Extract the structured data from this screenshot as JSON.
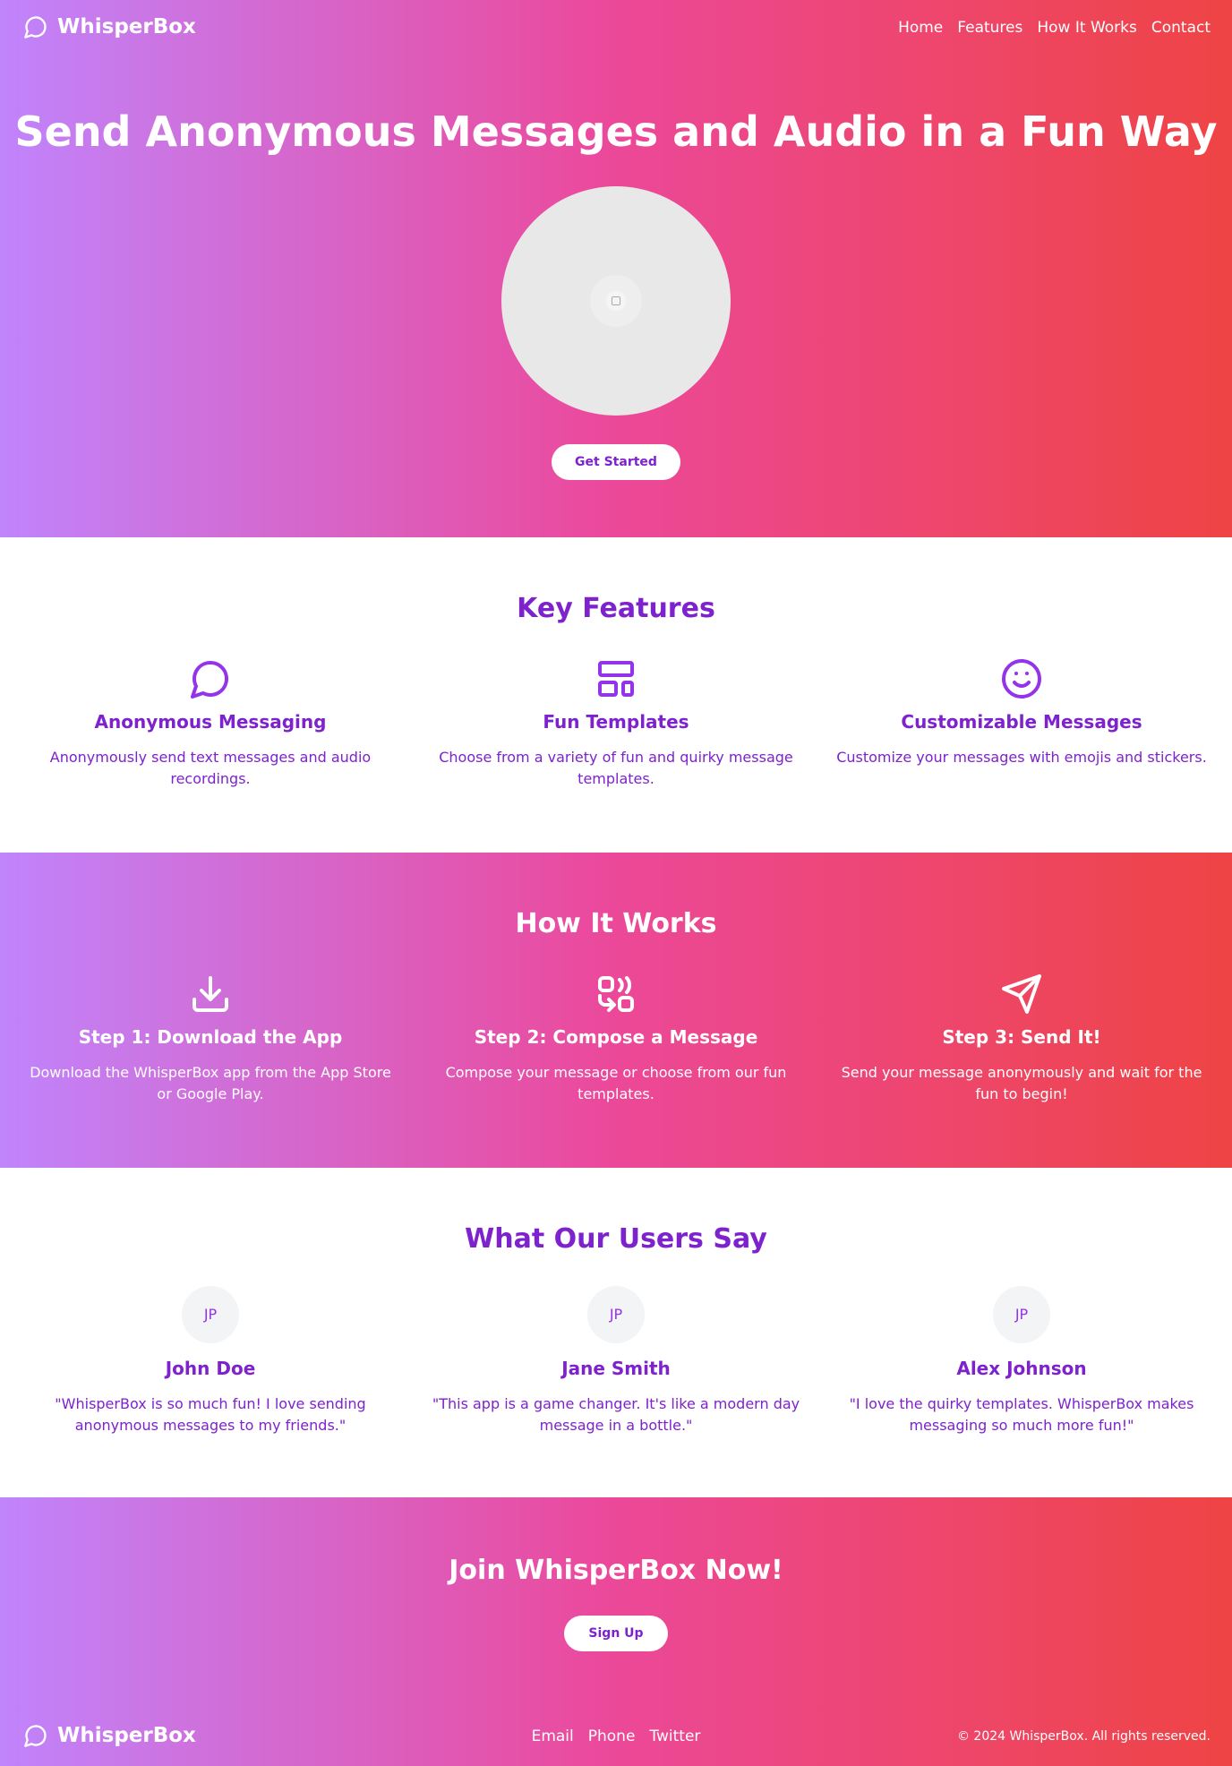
{
  "header": {
    "brand": "WhisperBox",
    "nav": [
      "Home",
      "Features",
      "How It Works",
      "Contact"
    ]
  },
  "hero": {
    "title": "Send Anonymous Messages and Audio in a Fun Way",
    "cta": "Get Started"
  },
  "features": {
    "title": "Key Features",
    "items": [
      {
        "icon": "message-circle-icon",
        "title": "Anonymous Messaging",
        "text": "Anonymously send text messages and audio recordings."
      },
      {
        "icon": "layout-template-icon",
        "title": "Fun Templates",
        "text": "Choose from a variety of fun and quirky message templates."
      },
      {
        "icon": "smile-icon",
        "title": "Customizable Messages",
        "text": "Customize your messages with emojis and stickers."
      }
    ]
  },
  "how": {
    "title": "How It Works",
    "steps": [
      {
        "icon": "download-icon",
        "title": "Step 1: Download the App",
        "text": "Download the WhisperBox app from the App Store or Google Play."
      },
      {
        "icon": "compose-icon",
        "title": "Step 2: Compose a Message",
        "text": "Compose your message or choose from our fun templates."
      },
      {
        "icon": "send-icon",
        "title": "Step 3: Send It!",
        "text": "Send your message anonymously and wait for the fun to begin!"
      }
    ]
  },
  "testimonials": {
    "title": "What Our Users Say",
    "items": [
      {
        "avatar": "JP",
        "name": "John Doe",
        "quote": "\"WhisperBox is so much fun! I love sending anonymous messages to my friends.\""
      },
      {
        "avatar": "JP",
        "name": "Jane Smith",
        "quote": "\"This app is a game changer. It's like a modern day message in a bottle.\""
      },
      {
        "avatar": "JP",
        "name": "Alex Johnson",
        "quote": "\"I love the quirky templates. WhisperBox makes messaging so much more fun!\""
      }
    ]
  },
  "join": {
    "title": "Join WhisperBox Now!",
    "cta": "Sign Up"
  },
  "footer": {
    "brand": "WhisperBox",
    "links": [
      "Email",
      "Phone",
      "Twitter"
    ],
    "copyright": "© 2024 WhisperBox. All rights reserved."
  },
  "colors": {
    "gradient_start": "#c084fc",
    "gradient_mid": "#ec4899",
    "gradient_end": "#ef4444",
    "accent": "#7e22ce"
  }
}
